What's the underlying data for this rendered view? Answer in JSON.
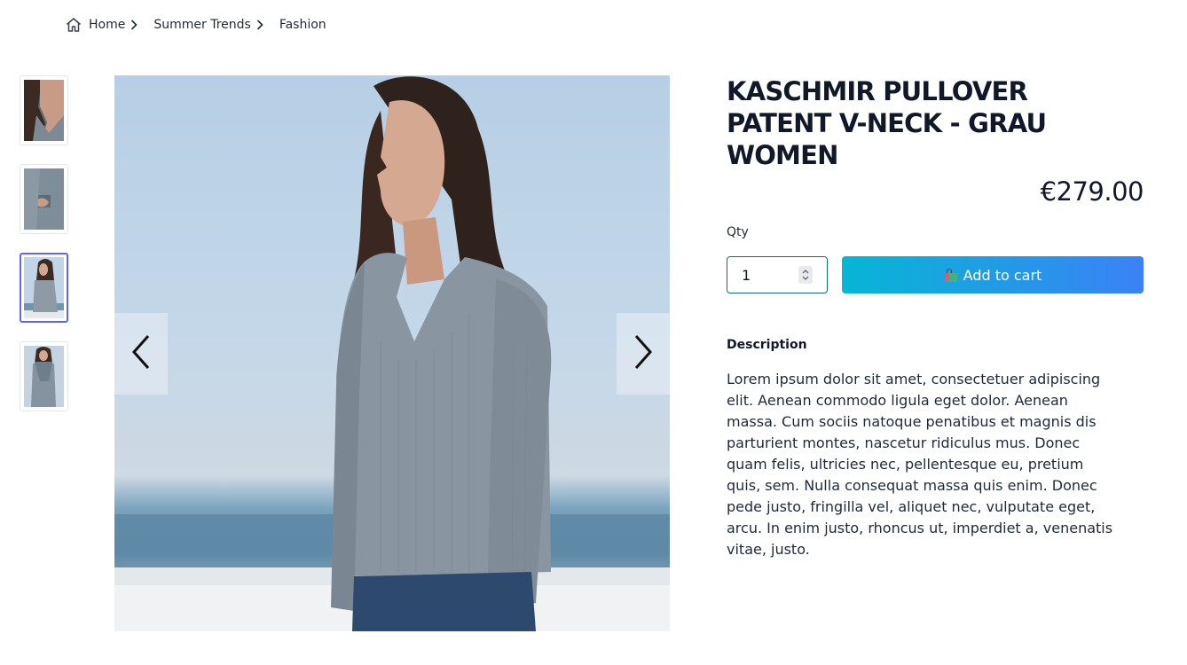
{
  "breadcrumb": {
    "items": [
      {
        "label": "Home",
        "icon": "home-icon"
      },
      {
        "label": "Summer Trends"
      },
      {
        "label": "Fashion"
      }
    ]
  },
  "gallery": {
    "thumbnails": [
      {
        "alt": "neckline detail"
      },
      {
        "alt": "sleeve detail"
      },
      {
        "alt": "full view",
        "active": true
      },
      {
        "alt": "scarf view"
      }
    ],
    "prev_icon": "chevron-left-icon",
    "next_icon": "chevron-right-icon"
  },
  "product": {
    "title": "KASCHMIR PULLOVER PATENT V-NECK - GRAU WOMEN",
    "price": "€279.00",
    "qty_label": "Qty",
    "qty_value": "1",
    "add_to_cart_label": "Add to cart",
    "description_heading": "Description",
    "description": "Lorem ipsum dolor sit amet, consectetuer adipiscing elit. Aenean commodo ligula eget dolor. Aenean massa. Cum sociis natoque penatibus et magnis dis parturient montes, nascetur ridiculus mus. Donec quam felis, ultricies nec, pellentesque eu, pretium quis, sem. Nulla consequat massa quis enim. Donec pede justo, fringilla vel, aliquet nec, vulputate eget, arcu. In enim justo, rhoncus ut, imperdiet a, venenatis vitae, justo."
  },
  "colors": {
    "accent_start": "#06b6d4",
    "accent_end": "#3b82f6",
    "active_thumb_border": "#6366f1"
  }
}
